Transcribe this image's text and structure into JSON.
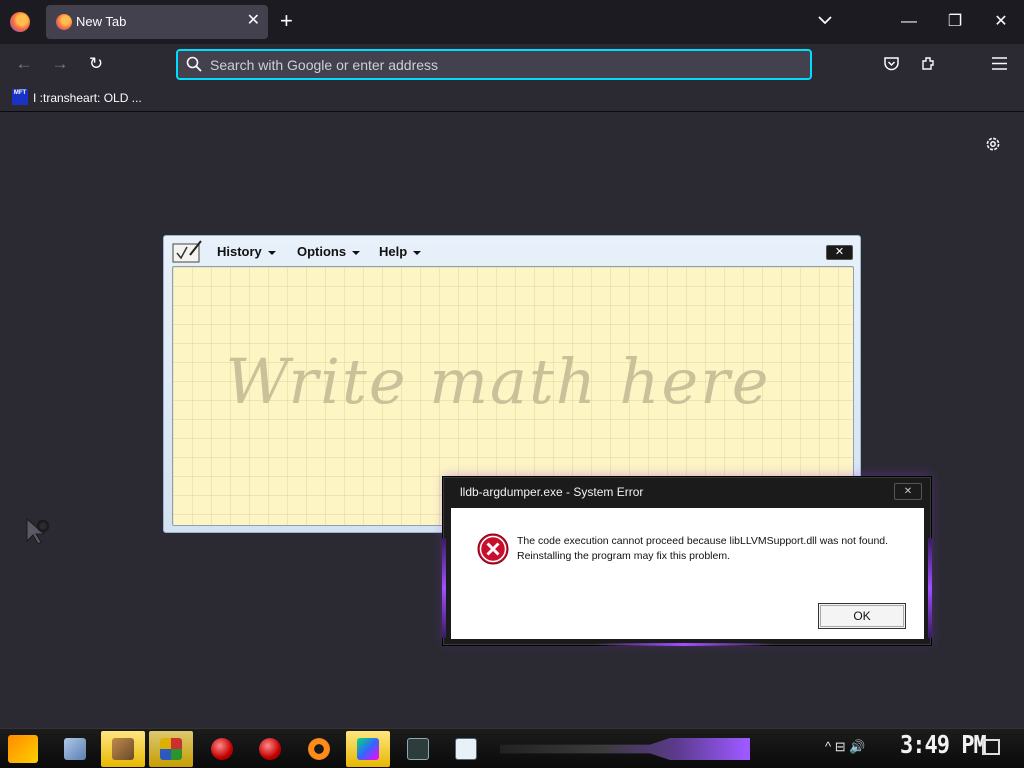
{
  "browser": {
    "tab": {
      "title": "New Tab",
      "close": "✕"
    },
    "new_tab": "+",
    "tab_list": "⌄",
    "window_controls": {
      "minimize": "—",
      "restore": "❐",
      "close": "✕"
    },
    "nav": {
      "back": "←",
      "forward": "→",
      "reload": "↻"
    },
    "urlbar": {
      "placeholder": "Search with Google or enter address",
      "value": ""
    },
    "toolbar_icons": [
      "pocket-icon",
      "extensions-icon",
      "menu-icon"
    ],
    "bookmark": {
      "icon_text": "MFT",
      "label": "I :transheart: OLD ..."
    },
    "accent_color": "#00ddff"
  },
  "math_panel": {
    "menus": [
      "History",
      "Options",
      "Help"
    ],
    "close": "✕",
    "hint": "Write math here"
  },
  "error_dialog": {
    "title": "lldb-argdumper.exe - System Error",
    "close": "✕",
    "message": "The code execution cannot proceed because libLLVMSupport.dll was not found. Reinstalling the program may fix this problem.",
    "ok": "OK"
  },
  "taskbar": {
    "clock": "3:49 PM",
    "tray": "^ ⊟ 🔊"
  }
}
